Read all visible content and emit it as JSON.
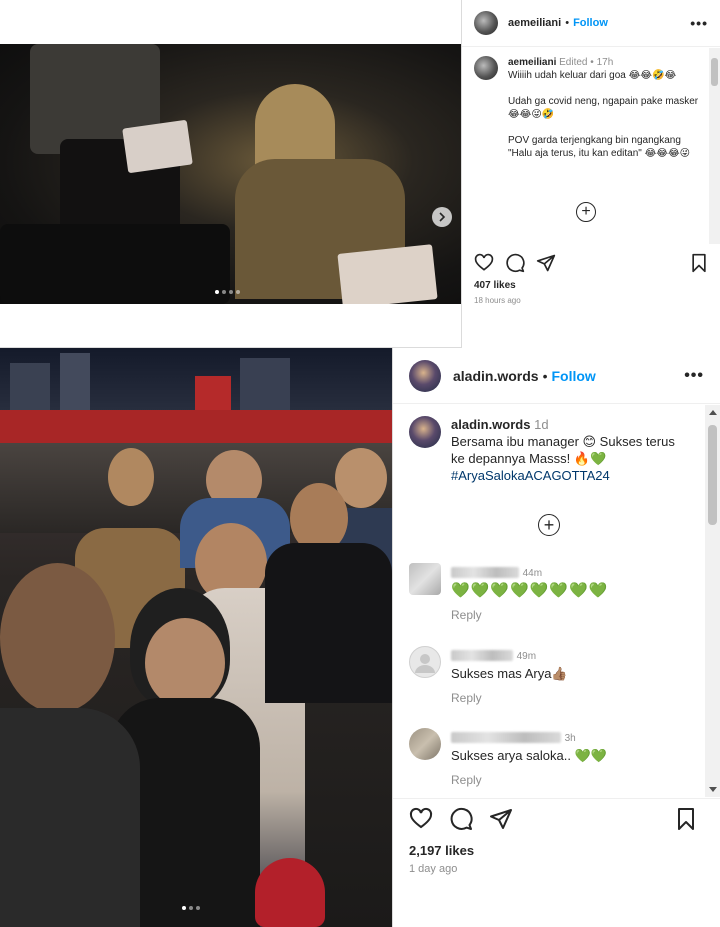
{
  "post1": {
    "username": "aemeiliani",
    "follow_label": "Follow",
    "separator": "•",
    "caption": {
      "username": "aemeiliani",
      "edited": "Edited",
      "age": "17h",
      "line1": "Wiiiih udah keluar dari goa 😂😂🤣😂",
      "line2": "Udah ga covid neng, ngapain pake masker 😂😂😜🤣",
      "line3": "POV garda terjengkang bin ngangkang \"Halu aja terus, itu kan editan\" 😂😂😂😜"
    },
    "likes": "407 likes",
    "time": "18 hours ago",
    "icons": [
      "heart-icon",
      "comment-icon",
      "share-icon",
      "bookmark-icon",
      "next-arrow-icon",
      "mute-icon"
    ]
  },
  "post2": {
    "username": "aladin.words",
    "follow_label": "Follow",
    "separator": "•",
    "caption": {
      "username": "aladin.words",
      "age": "1d",
      "text": "Bersama ibu manager 😊 Sukses terus ke depannya Masss! 🔥💚",
      "hashtag": "#AryaSalokaACAGOTTA24"
    },
    "comments": [
      {
        "time": "44m",
        "text": "💚💚💚💚💚💚💚💚",
        "reply": "Reply",
        "avatar_color": "#cfcfcf"
      },
      {
        "time": "49m",
        "text": "Sukses mas Arya👍🏽",
        "reply": "Reply",
        "avatar_color": "#e6e6e6"
      },
      {
        "time": "3h",
        "text": "Sukses arya saloka.. 💚💚",
        "reply": "Reply",
        "avatar_color": "#b8b0a4"
      }
    ],
    "likes": "2,197 likes",
    "time": "1 day ago",
    "icons": [
      "heart-icon",
      "comment-icon",
      "share-icon",
      "bookmark-icon"
    ]
  }
}
